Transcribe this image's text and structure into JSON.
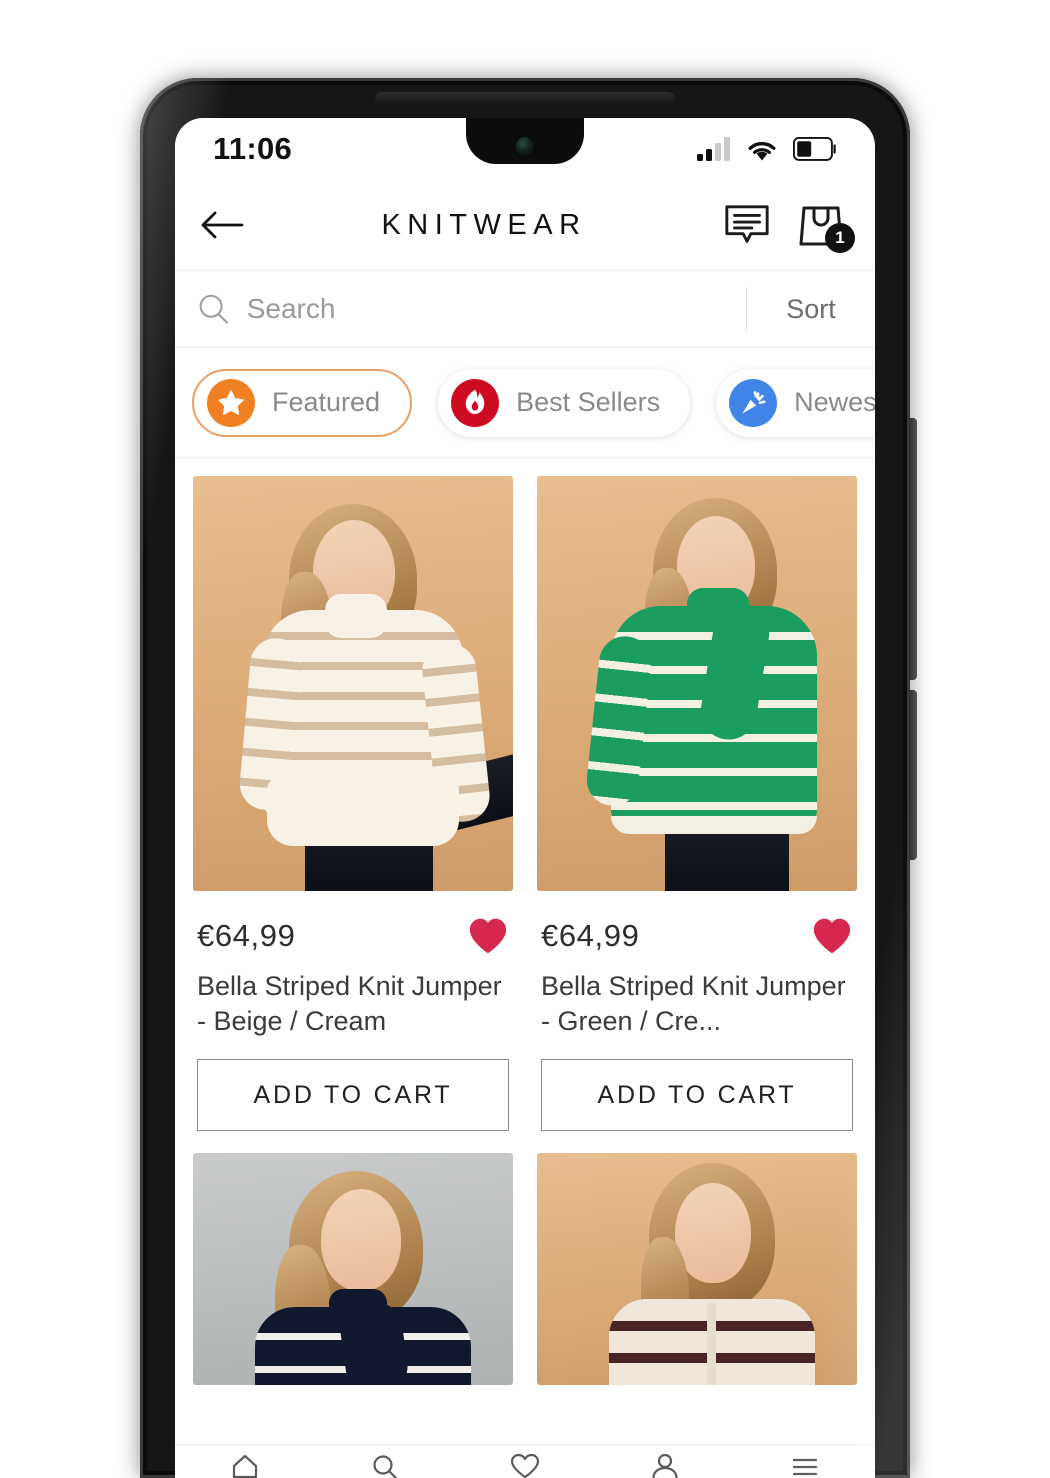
{
  "status_bar": {
    "time": "11:06",
    "signal_icon": "cellular-signal-icon",
    "wifi_icon": "wifi-icon",
    "battery_icon": "battery-icon",
    "battery_level_pct": 40
  },
  "top_nav": {
    "back_icon": "back-arrow-icon",
    "title": "KNITWEAR",
    "chat_icon": "chat-bubble-icon",
    "cart_icon": "shopping-bag-icon",
    "cart_badge": "1"
  },
  "search": {
    "icon": "search-icon",
    "placeholder": "Search",
    "value": "",
    "sort_label": "Sort"
  },
  "filters": {
    "chips": [
      {
        "label": "Featured",
        "icon": "star-icon",
        "color": "#F08022",
        "active": true
      },
      {
        "label": "Best Sellers",
        "icon": "flame-icon",
        "color": "#CE0A20",
        "active": false
      },
      {
        "label": "Newes",
        "icon": "party-popper-icon",
        "color": "#4285E8",
        "active": false
      }
    ]
  },
  "colors": {
    "accent_orange": "#F08022",
    "accent_red": "#CE0A20",
    "accent_blue": "#4285E8",
    "favorite_heart": "#D6284F",
    "chip_active_border": "#E8A064"
  },
  "products": [
    {
      "price": "€64,99",
      "title": "Bella Striped Knit Jumper - Beige / Cream",
      "favorite_icon": "heart-filled-icon",
      "favorited": true,
      "add_to_cart_label": "ADD TO CART",
      "image_alt": "model-in-beige-cream-striped-turtleneck"
    },
    {
      "price": "€64,99",
      "title": "Bella Striped Knit Jumper - Green / Cre...",
      "favorite_icon": "heart-filled-icon",
      "favorited": true,
      "add_to_cart_label": "ADD TO CART",
      "image_alt": "model-in-green-white-striped-turtleneck"
    },
    {
      "image_alt": "model-in-navy-white-striped-knit"
    },
    {
      "image_alt": "model-in-brown-white-striped-cardigan"
    }
  ],
  "bottom_nav": {
    "items": [
      {
        "icon": "home-icon"
      },
      {
        "icon": "search-icon"
      },
      {
        "icon": "heart-icon"
      },
      {
        "icon": "user-icon"
      },
      {
        "icon": "menu-icon"
      }
    ]
  }
}
